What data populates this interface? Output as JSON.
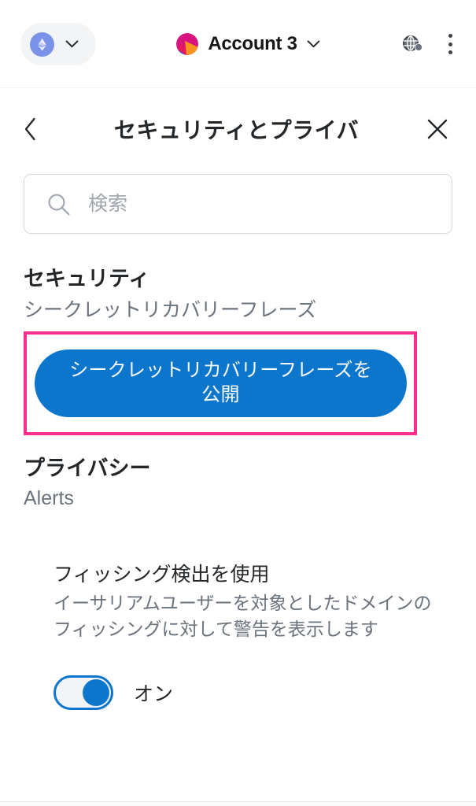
{
  "appbar": {
    "network": {
      "name": "network-selector",
      "icon": "ethereum-icon",
      "chevron": "chevron-down-icon"
    },
    "account": {
      "name": "Account 3",
      "avatar": "account-avatar",
      "chevron": "chevron-down-icon"
    },
    "connection_icon": "global-connection-icon",
    "menu_icon": "kebab-menu-icon"
  },
  "page_header": {
    "back_icon": "chevron-left-icon",
    "title": "セキュリティとプライバ",
    "close_icon": "close-icon"
  },
  "search": {
    "icon": "search-icon",
    "placeholder": "検索",
    "value": ""
  },
  "security": {
    "heading": "セキュリティ",
    "subheading": "シークレットリカバリーフレーズ",
    "reveal_button_label": "シークレットリカバリーフレーズを公開",
    "highlight_color": "#ff2d8e",
    "button_color": "#0b76cc"
  },
  "privacy": {
    "heading": "プライバシー",
    "subheading": "Alerts",
    "setting": {
      "label": "フィッシング検出を使用",
      "description": "イーサリアムユーザーを対象としたドメインのフィッシングに対して警告を表示します",
      "toggle_state_label": "オン",
      "toggle_on": true,
      "toggle_color": "#0b76cc"
    }
  }
}
